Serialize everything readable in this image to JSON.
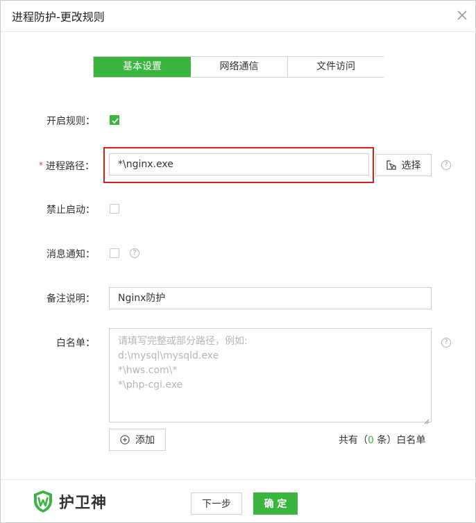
{
  "dialog": {
    "title": "进程防护-更改规则"
  },
  "tabs": [
    {
      "label": "基本设置",
      "active": true
    },
    {
      "label": "网络通信",
      "active": false
    },
    {
      "label": "文件访问",
      "active": false
    }
  ],
  "form": {
    "enable_rule": {
      "label": "开启规则：",
      "checked": true
    },
    "process_path": {
      "required_mark": "*",
      "label": "进程路径：",
      "value": "*\\nginx.exe",
      "select_label": "选择"
    },
    "forbid_start": {
      "label": "禁止启动：",
      "checked": false
    },
    "notify": {
      "label": "消息通知：",
      "checked": false
    },
    "remark": {
      "label": "备注说明：",
      "value": "Nginx防护"
    },
    "whitelist": {
      "label": "白名单：",
      "placeholder_lines": [
        "请填写完整或部分路径，例如:",
        "d:\\mysql\\mysqld.exe",
        "*\\hws.com\\*",
        "*\\php-cgi.exe"
      ],
      "add_label": "添加",
      "count_prefix": "共有（",
      "count_value": "0",
      "count_suffix": " 条）白名单"
    },
    "help_glyph": "?"
  },
  "footer": {
    "brand": "护卫神",
    "next_label": "下一步",
    "confirm_label": "确 定"
  },
  "colors": {
    "accent": "#3cb540",
    "highlight": "#d81e1e"
  }
}
